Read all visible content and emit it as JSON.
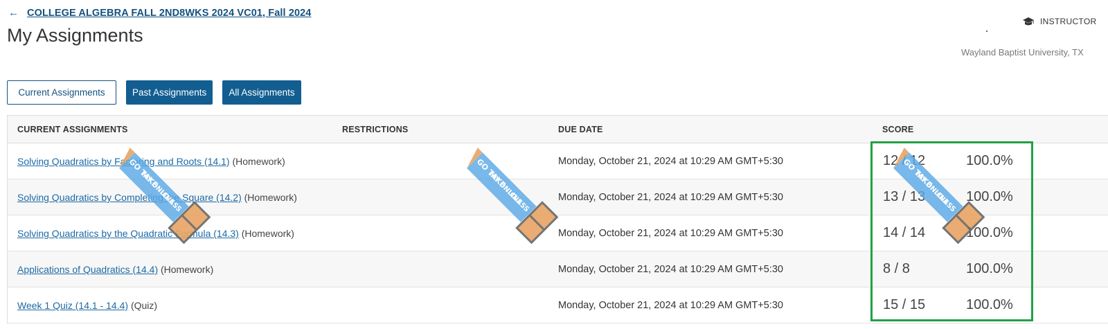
{
  "header": {
    "back_arrow": "←",
    "course_link": "COLLEGE ALGEBRA FALL 2ND8WKS 2024 VC01, Fall 2024",
    "page_title": "My Assignments",
    "instructor_label": "INSTRUCTOR",
    "university": "Wayland Baptist University, TX"
  },
  "tabs": [
    {
      "label": "Current Assignments",
      "active": true
    },
    {
      "label": "Past Assignments",
      "active": false
    },
    {
      "label": "All Assignments",
      "active": false
    }
  ],
  "table": {
    "columns": [
      "CURRENT ASSIGNMENTS",
      "RESTRICTIONS",
      "DUE DATE",
      "SCORE"
    ],
    "rows": [
      {
        "name": "Solving Quadratics by Factoring and Roots (14.1)",
        "type": "(Homework)",
        "due": "Monday, October 21, 2024 at 10:29 AM GMT+5:30",
        "score": "12 / 12",
        "percent": "100.0%"
      },
      {
        "name": "Solving Quadratics by Completing the Square (14.2)",
        "type": "(Homework)",
        "due": "Monday, October 21, 2024 at 10:29 AM GMT+5:30",
        "score": "13 / 13",
        "percent": "100.0%"
      },
      {
        "name": "Solving Quadratics by the Quadratic Formula (14.3)",
        "type": "(Homework)",
        "due": "Monday, October 21, 2024 at 10:29 AM GMT+5:30",
        "score": "14 / 14",
        "percent": "100.0%"
      },
      {
        "name": "Applications of Quadratics (14.4)",
        "type": "(Homework)",
        "due": "Monday, October 21, 2024 at 10:29 AM GMT+5:30",
        "score": "8 / 8",
        "percent": "100.0%"
      },
      {
        "name": "Week 1 Quiz (14.1 - 14.4)",
        "type": "(Quiz)",
        "due": "Monday, October 21, 2024 at 10:29 AM GMT+5:30",
        "score": "15 / 15",
        "percent": "100.0%"
      }
    ]
  },
  "watermark": {
    "lines": [
      "GO TAKE",
      "MY ONLINE",
      "CLASS"
    ]
  },
  "colors": {
    "primary": "#125e91",
    "link": "#1d6aa5",
    "highlight": "#21a144",
    "watermark_book": "#e8a463",
    "watermark_banner": "#5aa9e6"
  }
}
